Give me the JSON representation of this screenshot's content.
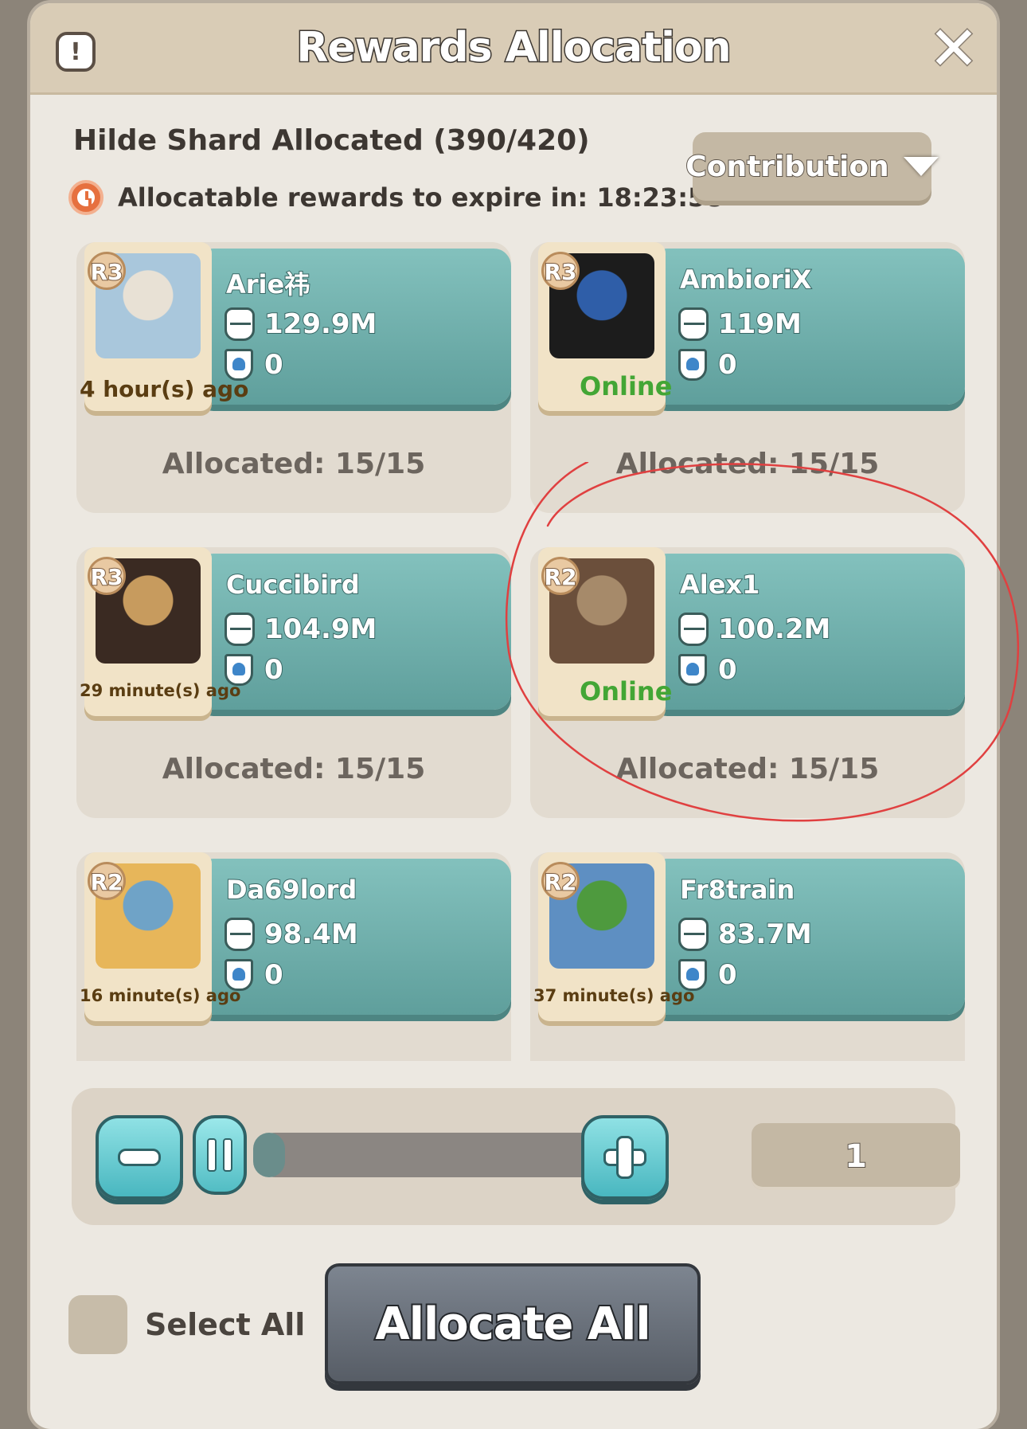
{
  "dialog": {
    "title": "Rewards Allocation",
    "info_icon": "exclamation-icon",
    "close_icon": "close-icon"
  },
  "header": {
    "allocated_label": "Hilde Shard Allocated (390/420)",
    "expire_label": "Allocatable rewards to expire in: 18:23:58",
    "sort_button": "Contribution"
  },
  "players": [
    {
      "rank": "R3",
      "name": "Arie祎",
      "power": "129.9M",
      "shields": "0",
      "status": "4 hour(s) ago",
      "online": false,
      "allocated": "Allocated: 15/15"
    },
    {
      "rank": "R3",
      "name": "AmbioriX",
      "power": "119M",
      "shields": "0",
      "status": "Online",
      "online": true,
      "allocated": "Allocated: 15/15"
    },
    {
      "rank": "R3",
      "name": "Cuccibird",
      "power": "104.9M",
      "shields": "0",
      "status": "29 minute(s) ago",
      "online": false,
      "allocated": "Allocated: 15/15"
    },
    {
      "rank": "R2",
      "name": "Alex1",
      "power": "100.2M",
      "shields": "0",
      "status": "Online",
      "online": true,
      "allocated": "Allocated: 15/15"
    },
    {
      "rank": "R2",
      "name": "Da69lord",
      "power": "98.4M",
      "shields": "0",
      "status": "16 minute(s) ago",
      "online": false,
      "allocated": ""
    },
    {
      "rank": "R2",
      "name": "Fr8train",
      "power": "83.7M",
      "shields": "0",
      "status": "37 minute(s) ago",
      "online": false,
      "allocated": ""
    }
  ],
  "stepper": {
    "quantity": "1"
  },
  "footer": {
    "select_all": "Select All",
    "allocate_all": "Allocate All"
  },
  "colors": {
    "card_teal": "#6fb0ad",
    "online_green": "#43a635",
    "annotation_red": "#e04040"
  }
}
